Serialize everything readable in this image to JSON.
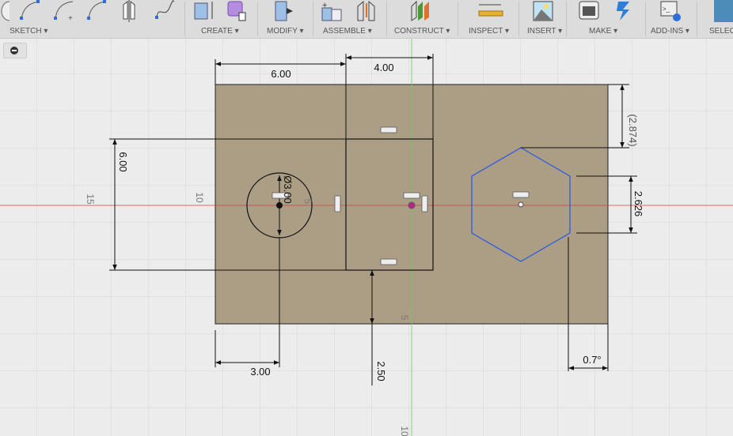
{
  "toolbar": {
    "groups": [
      {
        "label": "SKETCH ▾"
      },
      {
        "label": "CREATE ▾"
      },
      {
        "label": "MODIFY ▾"
      },
      {
        "label": "ASSEMBLE ▾"
      },
      {
        "label": "CONSTRUCT ▾"
      },
      {
        "label": "INSPECT ▾"
      },
      {
        "label": "INSERT ▾"
      },
      {
        "label": "MAKE ▾"
      },
      {
        "label": "ADD-INS ▾"
      },
      {
        "label": "SELEC"
      }
    ]
  },
  "sketch": {
    "dimensions": {
      "width_left": "6.00",
      "width_square": "4.00",
      "height_square": "6.00",
      "top_offset": "(2.874)",
      "hex_height": "2.626",
      "circle_x": "3.00",
      "square_bottom": "2.50",
      "hex_angle": "0.7°",
      "circle_diameter": "Ø3.00"
    },
    "axis_labels": {
      "a15": "15",
      "a10": "10",
      "a5": "5",
      "b5": "5",
      "b10": "10"
    },
    "colors": {
      "profile": "#a89a80",
      "hexagon": "#2a5be0",
      "x_axis": "#d04040",
      "y_axis": "#6ccf5a"
    }
  }
}
